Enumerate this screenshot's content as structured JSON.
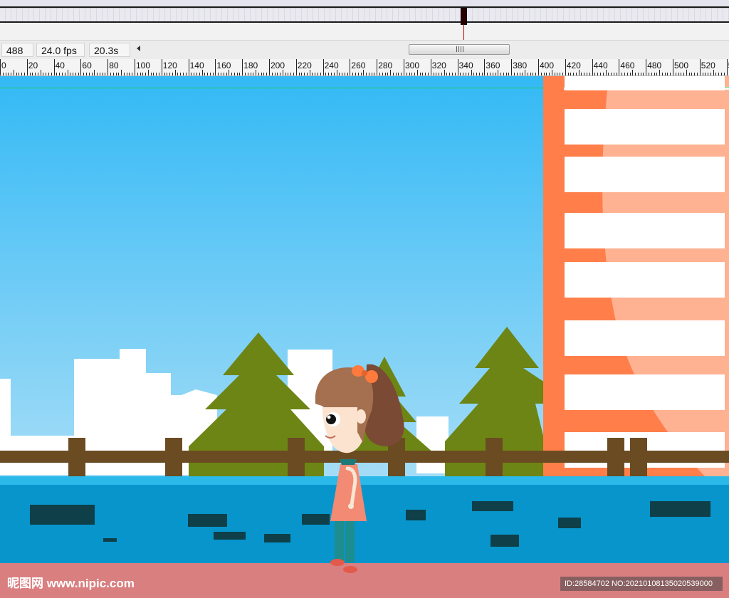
{
  "status": {
    "frame": "488",
    "fps": "24.0 fps",
    "time": "20.3s"
  },
  "scrollbar": {
    "grip": "III"
  },
  "ruler": {
    "labels": [
      "0",
      "20",
      "40",
      "60",
      "80",
      "100",
      "120",
      "140",
      "160",
      "180",
      "200",
      "220",
      "240",
      "260",
      "280",
      "300",
      "320",
      "340",
      "360",
      "380",
      "400",
      "420",
      "440",
      "460",
      "480",
      "500",
      "520",
      "5"
    ]
  },
  "colors": {
    "sky_top": "#33b9f5",
    "sky_bottom": "#a6ddf7",
    "tree": "#6d8514",
    "fence": "#6b4c22",
    "wall_top": "#2ab9e8",
    "wall": "#0795cc",
    "brick": "#0f3f48",
    "sidewalk": "#d97f80",
    "building": "#ff7e4a",
    "building_light": "#ffb292"
  },
  "icons": {
    "scroll_left": "caret-left-icon",
    "playhead": "playhead-icon"
  },
  "watermark": {
    "left": "昵图网 www.nipic.com",
    "right": "ID:28584702 NO:20210108135020539000"
  }
}
